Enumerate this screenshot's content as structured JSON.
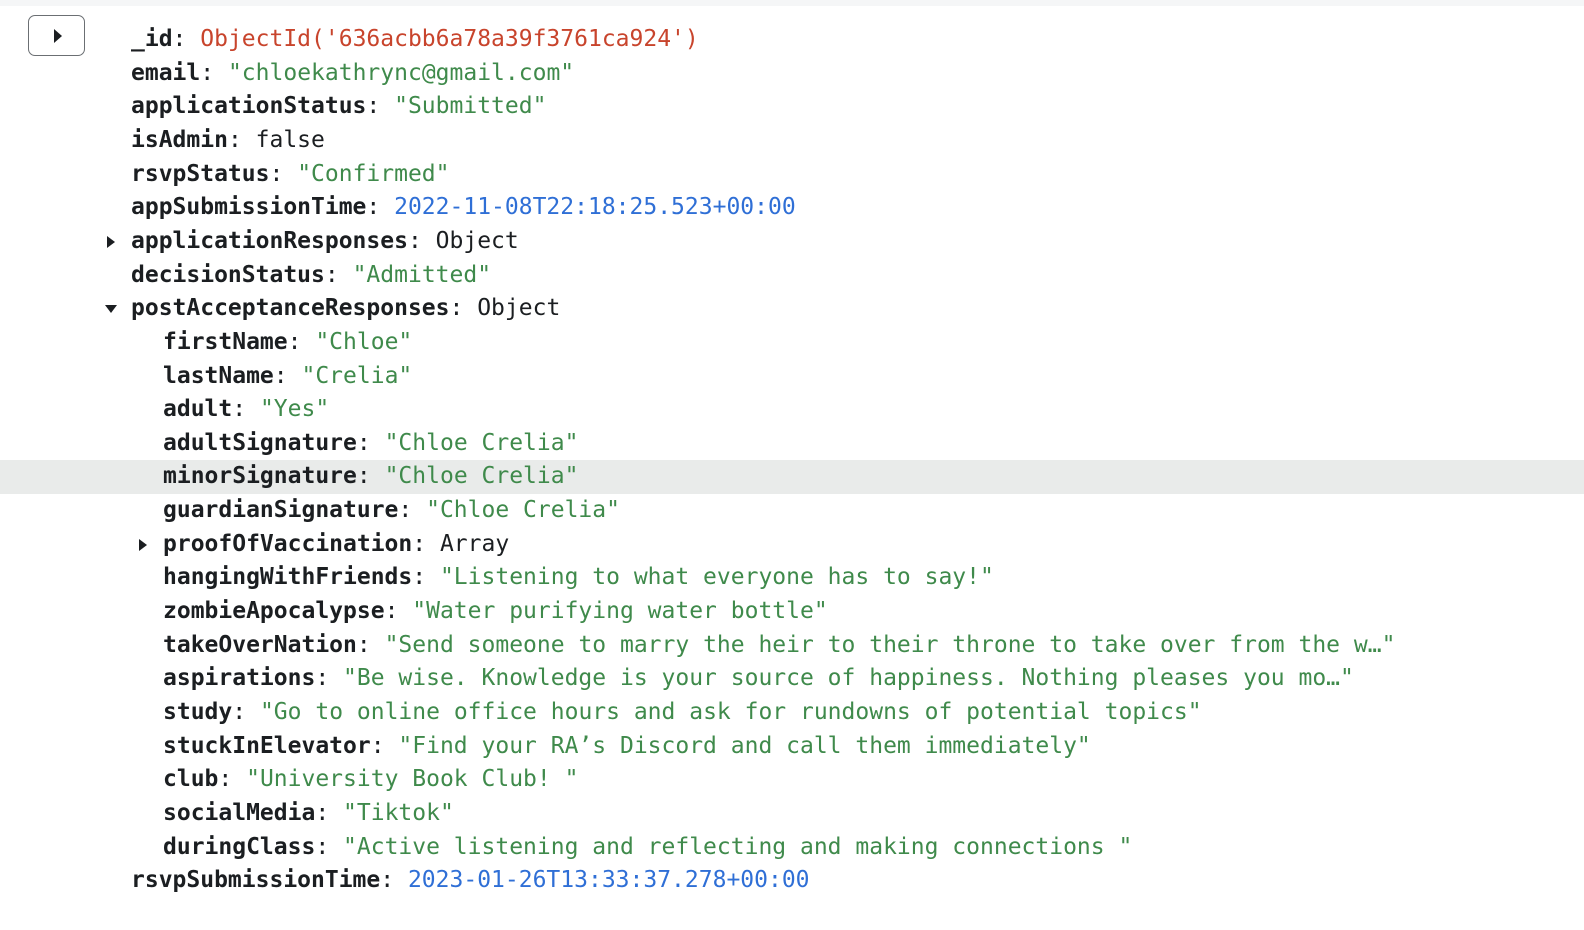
{
  "document": {
    "rows": [
      {
        "key": "_id",
        "value": "ObjectId('636acbb6a78a39f3761ca924')",
        "type": "oid",
        "depth": 0
      },
      {
        "key": "email",
        "value": "\"chloekathrync@gmail.com\"",
        "type": "string",
        "depth": 0
      },
      {
        "key": "applicationStatus",
        "value": "\"Submitted\"",
        "type": "string",
        "depth": 0
      },
      {
        "key": "isAdmin",
        "value": "false",
        "type": "plain",
        "depth": 0
      },
      {
        "key": "rsvpStatus",
        "value": "\"Confirmed\"",
        "type": "string",
        "depth": 0
      },
      {
        "key": "appSubmissionTime",
        "value": "2022-11-08T22:18:25.523+00:00",
        "type": "date",
        "depth": 0
      },
      {
        "key": "applicationResponses",
        "value": "Object",
        "type": "plain",
        "depth": 0,
        "toggle": "collapsed"
      },
      {
        "key": "decisionStatus",
        "value": "\"Admitted\"",
        "type": "string",
        "depth": 0
      },
      {
        "key": "postAcceptanceResponses",
        "value": "Object",
        "type": "plain",
        "depth": 0,
        "toggle": "expanded"
      },
      {
        "key": "firstName",
        "value": "\"Chloe\"",
        "type": "string",
        "depth": 1
      },
      {
        "key": "lastName",
        "value": "\"Crelia\"",
        "type": "string",
        "depth": 1
      },
      {
        "key": "adult",
        "value": "\"Yes\"",
        "type": "string",
        "depth": 1
      },
      {
        "key": "adultSignature",
        "value": "\"Chloe Crelia\"",
        "type": "string",
        "depth": 1
      },
      {
        "key": "minorSignature",
        "value": "\"Chloe Crelia\"",
        "type": "string",
        "depth": 1,
        "highlight": true
      },
      {
        "key": "guardianSignature",
        "value": "\"Chloe Crelia\"",
        "type": "string",
        "depth": 1
      },
      {
        "key": "proofOfVaccination",
        "value": "Array",
        "type": "plain",
        "depth": 1,
        "toggle": "collapsed"
      },
      {
        "key": "hangingWithFriends",
        "value": "\"Listening to what everyone has to say!\"",
        "type": "string",
        "depth": 1
      },
      {
        "key": "zombieApocalypse",
        "value": "\"Water purifying water bottle\"",
        "type": "string",
        "depth": 1
      },
      {
        "key": "takeOverNation",
        "value": "\"Send someone to marry the heir to their throne to take over from the w…\"",
        "type": "string",
        "depth": 1
      },
      {
        "key": "aspirations",
        "value": "\"Be wise. Knowledge is your source of happiness. Nothing pleases you mo…\"",
        "type": "string",
        "depth": 1
      },
      {
        "key": "study",
        "value": "\"Go to online office hours and ask for rundowns of potential topics\"",
        "type": "string",
        "depth": 1
      },
      {
        "key": "stuckInElevator",
        "value": "\"Find your RA’s Discord and call them immediately\"",
        "type": "string",
        "depth": 1
      },
      {
        "key": "club",
        "value": "\"University Book Club! \"",
        "type": "string",
        "depth": 1
      },
      {
        "key": "socialMedia",
        "value": "\"Tiktok\"",
        "type": "string",
        "depth": 1
      },
      {
        "key": "duringClass",
        "value": "\"Active listening and reflecting and making connections \"",
        "type": "string",
        "depth": 1
      },
      {
        "key": "rsvpSubmissionTime",
        "value": "2023-01-26T13:33:37.278+00:00",
        "type": "date",
        "depth": 0
      }
    ]
  },
  "colors": {
    "string": "#3f8a4b",
    "date": "#2f6fd6",
    "objectId": "#c8442c",
    "highlight_row": "#e9ebea"
  },
  "icons": {
    "expand_button": "caret-right-icon",
    "collapsed_toggle": "caret-right-icon",
    "expanded_toggle": "caret-down-icon"
  }
}
